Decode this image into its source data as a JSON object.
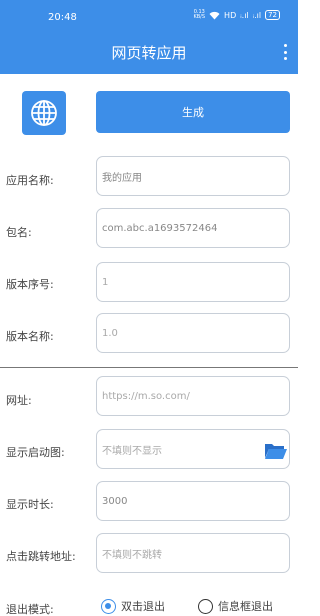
{
  "status_bar": {
    "time": "20:48",
    "speed_value": "0.13",
    "speed_unit": "KB/S",
    "signal_1": "ᵢ.ıl",
    "hd": "HD",
    "signal_2": "ᵢ.ıl",
    "battery": "72"
  },
  "app_bar": {
    "title": "网页转应用",
    "menu_icon": "more-vert-icon"
  },
  "actions": {
    "globe_icon": "globe-icon",
    "generate_label": "生成"
  },
  "form": {
    "app_name": {
      "label": "应用名称:",
      "value": "我的应用"
    },
    "package": {
      "label": "包名:",
      "value": "com.abc.a1693572464"
    },
    "version_code": {
      "label": "版本序号:",
      "value": "1"
    },
    "version_name": {
      "label": "版本名称:",
      "value": "1.0"
    },
    "url": {
      "label": "网址:",
      "value": "https://m.so.com/"
    },
    "splash": {
      "label": "显示启动图:",
      "placeholder": "不填则不显示",
      "folder_icon": "folder-open-icon"
    },
    "duration": {
      "label": "显示时长:",
      "value": "3000"
    },
    "click_url": {
      "label": "点击跳转地址:",
      "placeholder": "不填则不跳转"
    },
    "exit_mode": {
      "label": "退出模式:",
      "options": [
        "双击退出",
        "信息框退出"
      ],
      "selected": "双击退出"
    }
  },
  "colors": {
    "primary": "#3d8ee8",
    "field_border": "#c8cfd8"
  }
}
